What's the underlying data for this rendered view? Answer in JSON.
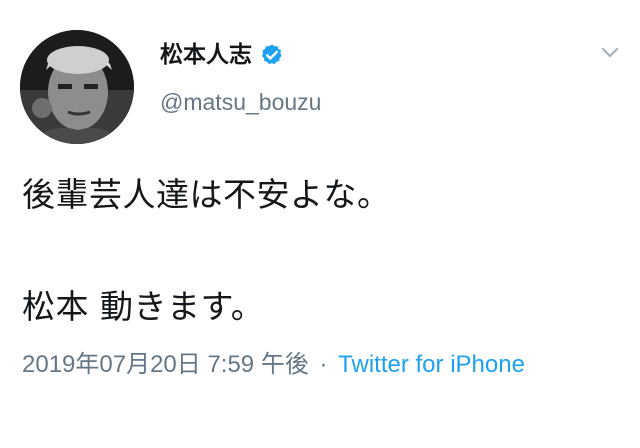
{
  "tweet": {
    "display_name": "松本人志",
    "verified": true,
    "handle": "@matsu_bouzu",
    "text_line1": "後輩芸人達は不安よな。",
    "text_line2": "松本 動きます。",
    "timestamp": "2019年07月20日 7:59 午後",
    "separator": "·",
    "source": "Twitter for iPhone",
    "icons": {
      "verified": "verified-badge-icon",
      "menu": "chevron-down-icon"
    }
  },
  "colors": {
    "text": "#14171a",
    "secondary": "#657786",
    "link": "#1da1f2",
    "background": "#ffffff"
  }
}
